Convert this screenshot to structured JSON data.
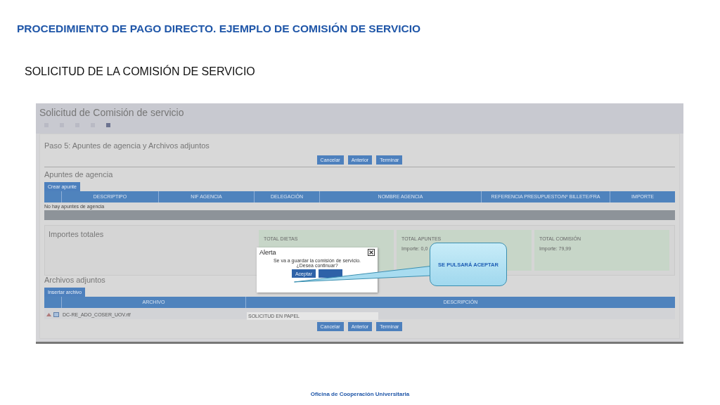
{
  "slide_title": "PROCEDIMIENTO DE PAGO DIRECTO. EJEMPLO DE COMISIÓN DE SERVICIO",
  "subtitle": "SOLICITUD DE LA COMISIÓN DE SERVICIO",
  "app": {
    "title": "Solicitud de Comisión de servicio",
    "steps": [
      {
        "selected": false
      },
      {
        "selected": false
      },
      {
        "selected": false
      },
      {
        "selected": false
      },
      {
        "selected": true
      }
    ],
    "step_title": "Paso 5: Apuntes de agencia y Archivos adjuntos",
    "nav_buttons": [
      "Cancelar",
      "Anterior",
      "Terminar"
    ],
    "apuntes": {
      "title": "Apuntes de agencia",
      "add_button": "Crear apunte",
      "columns": [
        "DESCRIPTIPO",
        "NIF AGENCIA",
        "DELEGACIÓN",
        "NOMBRE AGENCIA",
        "REFERENCIA PRESUPUESTO/Nº BILLETE/FRA",
        "IMPORTE"
      ],
      "empty": "No hay apuntes de agencia"
    },
    "totals": {
      "title": "Importes totales",
      "boxes": [
        {
          "label": "TOTAL DIETAS"
        },
        {
          "label": "TOTAL APUNTES",
          "value": "Importe: 0,0"
        },
        {
          "label": "TOTAL COMISIÓN",
          "value": "Importe: 79,99"
        }
      ]
    },
    "archivos": {
      "title": "Archivos adjuntos",
      "add_button": "Insertar archivo",
      "columns": [
        "ARCHIVO",
        "DESCRIPCIÓN"
      ],
      "rows": [
        {
          "file": "DC-RE_ADO_COSER_UOV.rtf",
          "description": "SOLICITUD EN PAPEL"
        }
      ]
    },
    "bottom_buttons": [
      "Cancelar",
      "Anterior",
      "Terminar"
    ]
  },
  "dialog": {
    "title": "Alerta",
    "message": "Se va a guardar la comisión de servicio. ¿Desea continuar?",
    "buttons": [
      "Aceptar"
    ]
  },
  "callout": "SE PULSARÁ ACEPTAR",
  "footer": "Oficina de Cooperación Universitaria"
}
